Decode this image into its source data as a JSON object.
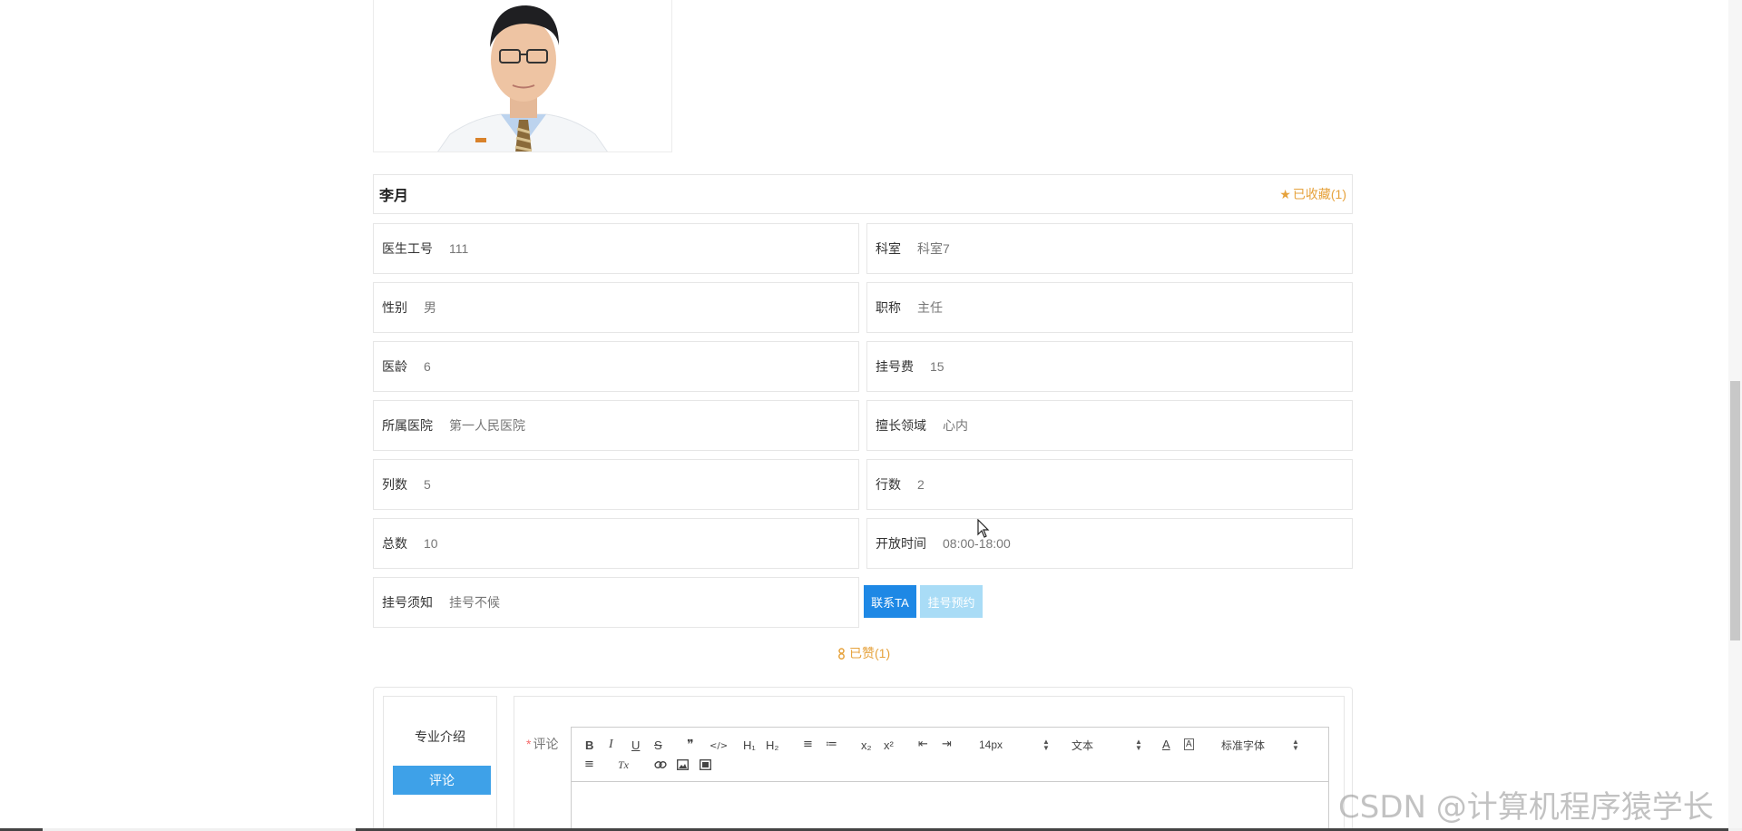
{
  "doctor": {
    "name": "李月",
    "favorite_label": "已收藏(1)"
  },
  "fields": [
    {
      "label": "医生工号",
      "value": "111"
    },
    {
      "label": "科室",
      "value": "科室7"
    },
    {
      "label": "性别",
      "value": "男"
    },
    {
      "label": "职称",
      "value": "主任"
    },
    {
      "label": "医龄",
      "value": "6"
    },
    {
      "label": "挂号费",
      "value": "15"
    },
    {
      "label": "所属医院",
      "value": "第一人民医院"
    },
    {
      "label": "擅长领域",
      "value": "心内"
    },
    {
      "label": "列数",
      "value": "5"
    },
    {
      "label": "行数",
      "value": "2"
    },
    {
      "label": "总数",
      "value": "10"
    },
    {
      "label": "开放时间",
      "value": "08:00-18:00"
    },
    {
      "label": "挂号须知",
      "value": "挂号不候"
    }
  ],
  "actions": {
    "contact_label": "联系TA",
    "book_label": "挂号预约",
    "like_label": "已赞(1)"
  },
  "tabs": {
    "intro_label": "专业介绍",
    "comment_tab_label": "评论"
  },
  "comment_form": {
    "required_mark": "*",
    "label": "评论"
  },
  "editor_toolbar": {
    "bold": "B",
    "italic": "I",
    "underline": "U",
    "strike": "S",
    "blockquote": "❞",
    "code": "</>",
    "h1": "H₁",
    "h2": "H₂",
    "ordered_list": "≡",
    "bullet_list": "≔",
    "subscript": "x₂",
    "superscript": "x²",
    "outdent": "⇤",
    "indent": "⇥",
    "size_value": "14px",
    "header_value": "文本",
    "font_value": "标准字体",
    "color": "A",
    "background": "A",
    "align": "≡",
    "clean": "Tx"
  },
  "watermark": "CSDN @计算机程序猿学长",
  "colors": {
    "accent_blue": "#1e88e5",
    "disabled_blue": "#a9dcf6",
    "favorite_orange": "#e6a23c",
    "side_button_blue": "#3ea1e8"
  }
}
